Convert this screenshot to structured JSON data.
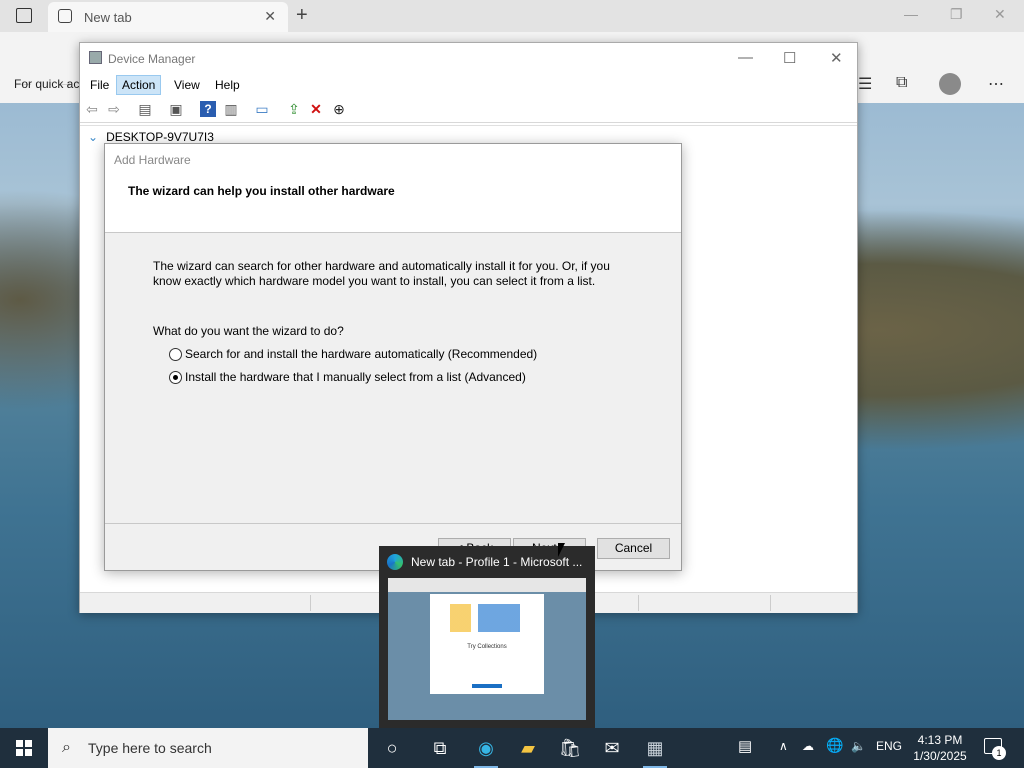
{
  "edge": {
    "tab_title": "New tab",
    "quick_access": "For quick ac"
  },
  "device_manager": {
    "title": "Device Manager",
    "menu": [
      "File",
      "Action",
      "View",
      "Help"
    ],
    "active_menu": "Action",
    "tree_root": "DESKTOP-9V7U7I3"
  },
  "wizard": {
    "title": "Add Hardware",
    "heading": "The wizard can help you install other hardware",
    "description": "The wizard can search for other hardware and automatically install it for you. Or, if you know exactly which hardware model you want to install, you can select it from a list.",
    "question": "What do you want the wizard to do?",
    "options": [
      {
        "label": "Search for and install the hardware automatically (Recommended)",
        "checked": false
      },
      {
        "label": "Install the hardware that I manually select from a list (Advanced)",
        "checked": true
      }
    ],
    "back_label": "< Back",
    "next_label": "Next >",
    "cancel_label": "Cancel"
  },
  "thumbnail": {
    "title": "New tab - Profile 1 - Microsoft ...",
    "preview_card_title": "Try Collections"
  },
  "taskbar": {
    "search_placeholder": "Type here to search",
    "language": "ENG",
    "time": "4:13 PM",
    "date": "1/30/2025",
    "notification_count": "1"
  }
}
